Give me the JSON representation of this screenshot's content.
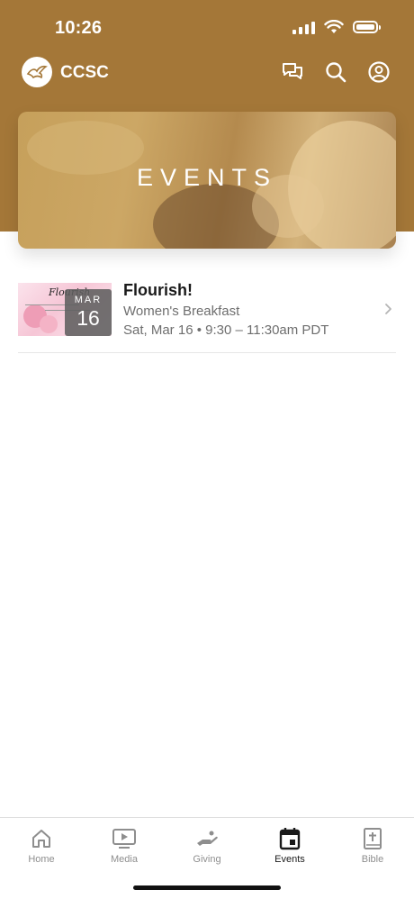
{
  "status_bar": {
    "time": "10:26"
  },
  "header": {
    "brand": "CCSC",
    "actions": [
      "messages-icon",
      "search-icon",
      "profile-icon"
    ]
  },
  "hero": {
    "title": "EVENTS"
  },
  "events": [
    {
      "title": "Flourish!",
      "subtitle": "Women's Breakfast",
      "datetime": "Sat, Mar 16 • 9:30 – 11:30am PDT",
      "badge_month": "MAR",
      "badge_day": "16",
      "thumbnail_text": "Flourish"
    }
  ],
  "tabs": [
    {
      "label": "Home",
      "icon": "home-icon",
      "active": false
    },
    {
      "label": "Media",
      "icon": "media-icon",
      "active": false
    },
    {
      "label": "Giving",
      "icon": "giving-icon",
      "active": false
    },
    {
      "label": "Events",
      "icon": "calendar-icon",
      "active": true
    },
    {
      "label": "Bible",
      "icon": "bible-icon",
      "active": false
    }
  ],
  "colors": {
    "accent": "#a47738",
    "text_muted": "#6e6e6e"
  }
}
